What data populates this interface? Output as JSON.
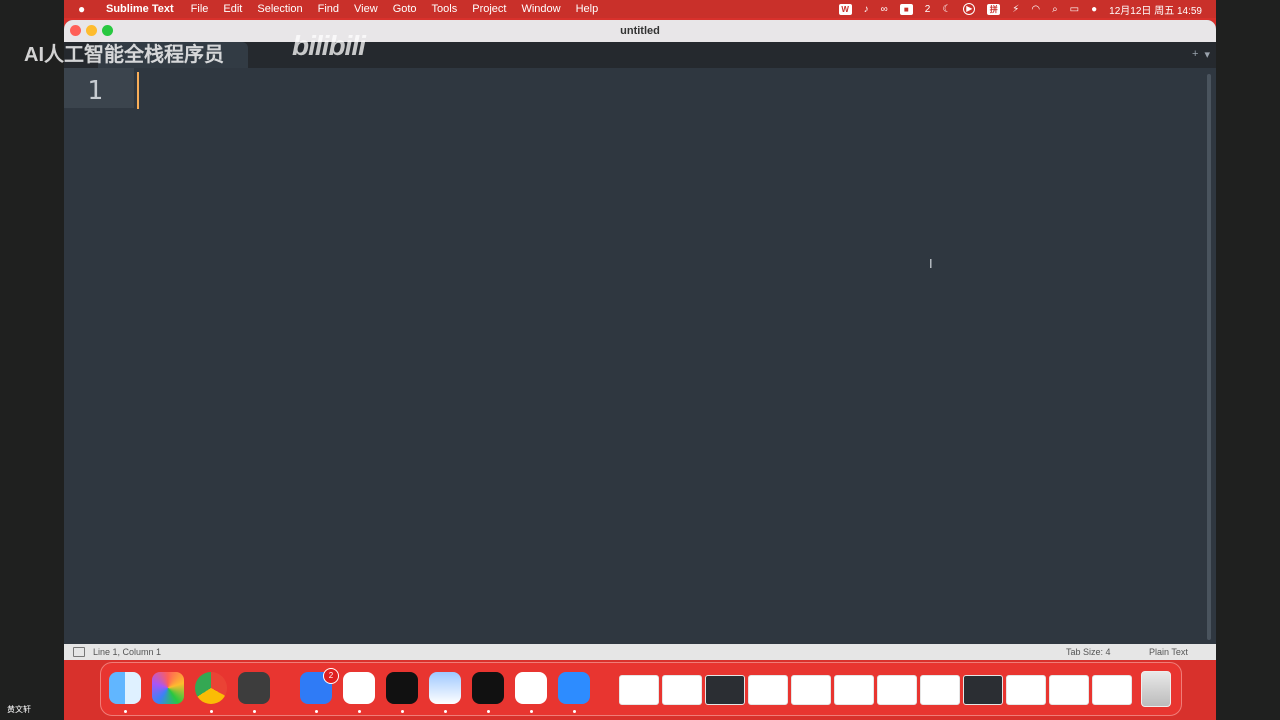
{
  "menubar": {
    "app_name": "Sublime Text",
    "menus": [
      "File",
      "Edit",
      "Selection",
      "Find",
      "View",
      "Goto",
      "Tools",
      "Project",
      "Window",
      "Help"
    ],
    "status_items": [
      "W",
      "♪",
      "∞",
      "■",
      "2",
      "☾",
      "▶",
      "拼",
      "⚡"
    ],
    "datetime": "12月12日 周五  14:59"
  },
  "window": {
    "title": "untitled"
  },
  "editor": {
    "line_number": "1"
  },
  "statusbar": {
    "position": "Line 1, Column 1",
    "tab_size": "Tab Size: 4",
    "syntax": "Plain Text"
  },
  "overlay": {
    "watermark_text": "AI人工智能全栈程序员",
    "watermark_logo": "bilibili",
    "corner_name": "黄文轩"
  },
  "dock": {
    "apps": [
      "finder-icon",
      "launchpad-icon",
      "chrome-icon",
      "sublime-icon",
      "feishu-icon",
      "baidu-netdisk-icon",
      "tiktok-icon",
      "preview-icon",
      "capcut-icon",
      "wps-icon",
      "zoom-icon"
    ],
    "badge": "2"
  },
  "colors": {
    "accent": "#d8312c",
    "editor_bg": "#2f3740",
    "caret": "#f9ae58"
  }
}
